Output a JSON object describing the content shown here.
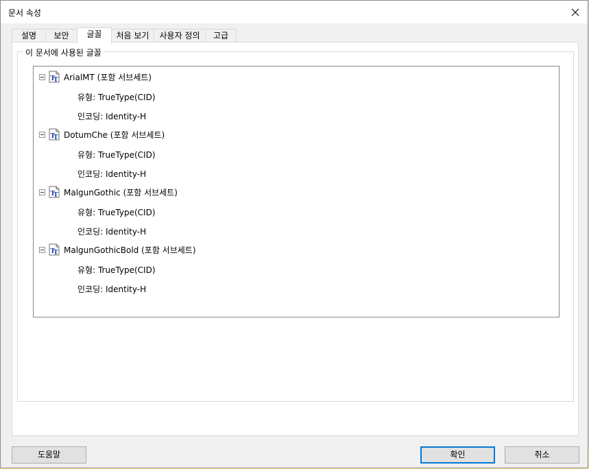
{
  "dialog": {
    "title": "문서 속성",
    "close_glyph": "✕"
  },
  "tabs": [
    {
      "label": "설명"
    },
    {
      "label": "보안"
    },
    {
      "label": "글꼴",
      "active": true
    },
    {
      "label": "처음 보기"
    },
    {
      "label": "사용자 정의"
    },
    {
      "label": "고급"
    }
  ],
  "fonts_group": {
    "legend": "이 문서에 사용된 글꼴",
    "fonts": [
      {
        "name": "ArialMT (포함 서브세트)",
        "type": "유형: TrueType(CID)",
        "encoding": "인코딩: Identity-H"
      },
      {
        "name": "DotumChe (포함 서브세트)",
        "type": "유형: TrueType(CID)",
        "encoding": "인코딩: Identity-H"
      },
      {
        "name": "MalgunGothic (포함 서브세트)",
        "type": "유형: TrueType(CID)",
        "encoding": "인코딩: Identity-H"
      },
      {
        "name": "MalgunGothicBold (포함 서브세트)",
        "type": "유형: TrueType(CID)",
        "encoding": "인코딩: Identity-H"
      }
    ]
  },
  "buttons": {
    "help": "도움말",
    "ok": "확인",
    "cancel": "취소"
  },
  "colors": {
    "accent": "#0078d7",
    "icon_blue": "#1a3fa8"
  }
}
